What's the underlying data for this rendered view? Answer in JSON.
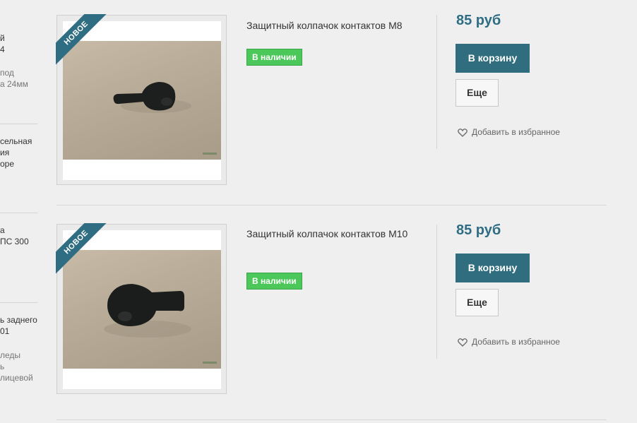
{
  "sidebar": {
    "items": [
      {
        "title_lines": [
          "й",
          "4"
        ],
        "desc_lines": [
          "под",
          "а 24мм"
        ]
      },
      {
        "title_lines": [
          "сельная",
          "ия",
          "оре"
        ],
        "desc_lines": []
      },
      {
        "title_lines": [
          "а",
          "ПС 300"
        ],
        "desc_lines": []
      },
      {
        "title_lines": [
          "ь заднего",
          "01"
        ],
        "desc_lines": [
          "леды",
          "ь",
          "лицевой"
        ]
      }
    ]
  },
  "products": [
    {
      "ribbon": "НОВОЕ",
      "title": "Защитный колпачок контактов М8",
      "badge": "В наличии",
      "price": "85 руб",
      "cart_label": "В корзину",
      "more_label": "Еще",
      "favorite_label": "Добавить в избранное"
    },
    {
      "ribbon": "НОВОЕ",
      "title": "Защитный колпачок контактов М10",
      "badge": "В наличии",
      "price": "85 руб",
      "cart_label": "В корзину",
      "more_label": "Еще",
      "favorite_label": "Добавить в избранное"
    }
  ],
  "colors": {
    "accent": "#2f6d7f",
    "price": "#2e6d82",
    "in_stock": "#4cc85a",
    "background": "#efefef"
  },
  "icons": {
    "favorite": "heart-outline-icon"
  }
}
